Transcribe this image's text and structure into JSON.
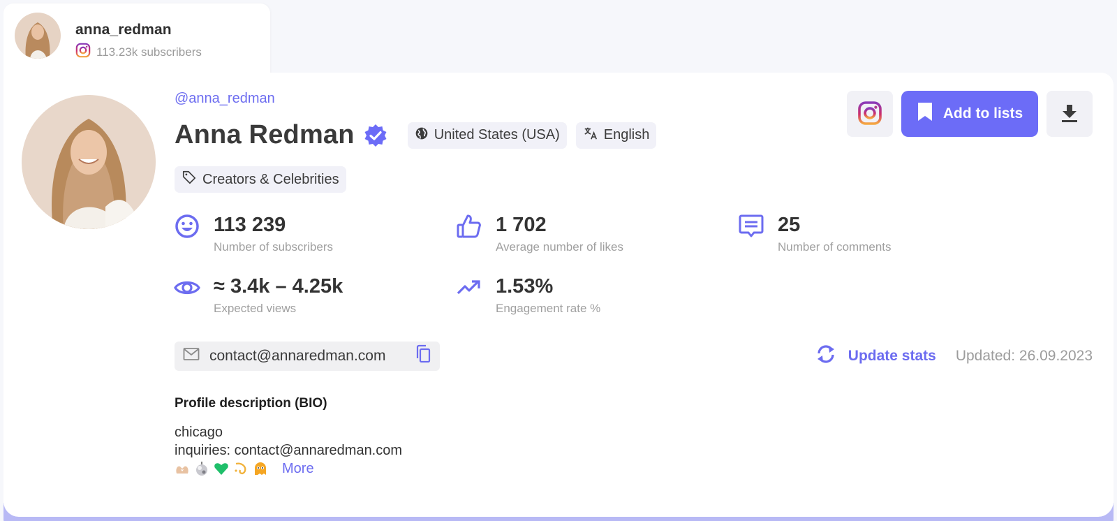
{
  "tab": {
    "username": "anna_redman",
    "subscribers": "113.23k subscribers",
    "platform_icon": "instagram-icon"
  },
  "profile": {
    "handle": "@anna_redman",
    "name": "Anna Redman",
    "verified": true,
    "country": "United States (USA)",
    "language": "English",
    "category": "Creators & Celebrities"
  },
  "actions": {
    "instagram_icon": "instagram-icon",
    "add_to_lists": "Add to lists",
    "download_icon": "download-icon"
  },
  "stats": [
    {
      "icon": "smiley-icon",
      "value": "113 239",
      "label": "Number of subscribers"
    },
    {
      "icon": "thumbs-up-icon",
      "value": "1 702",
      "label": "Average number of likes"
    },
    {
      "icon": "comment-icon",
      "value": "25",
      "label": "Number of comments"
    },
    {
      "icon": "eye-icon",
      "value": "≈ 3.4k – 4.25k",
      "label": "Expected views"
    },
    {
      "icon": "trending-up-icon",
      "value": "1.53%",
      "label": "Engagement rate %"
    }
  ],
  "contact": {
    "email": "contact@annaredman.com"
  },
  "update": {
    "button": "Update stats",
    "updated": "Updated: 26.09.2023"
  },
  "bio": {
    "title": "Profile description (BIO)",
    "line1": "chicago",
    "line2": "inquiries: contact@annaredman.com",
    "emojis": [
      "heart-hands",
      "disco-ball",
      "green-heart",
      "dizzy",
      "hugging-ghost"
    ],
    "more": "More"
  },
  "colors": {
    "accent": "#6c6cf7",
    "muted_text": "#9c9c9c",
    "chip_bg": "#f1f1f8",
    "page_bg": "#f6f7fb"
  }
}
